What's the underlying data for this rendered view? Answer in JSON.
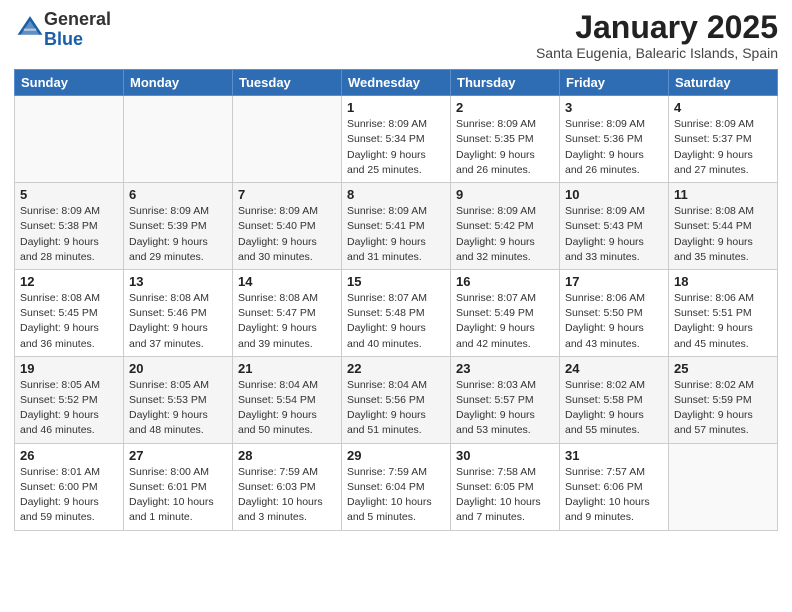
{
  "logo": {
    "text_general": "General",
    "text_blue": "Blue"
  },
  "header": {
    "month_title": "January 2025",
    "subtitle": "Santa Eugenia, Balearic Islands, Spain"
  },
  "weekdays": [
    "Sunday",
    "Monday",
    "Tuesday",
    "Wednesday",
    "Thursday",
    "Friday",
    "Saturday"
  ],
  "weeks": [
    [
      {
        "day": "",
        "info": ""
      },
      {
        "day": "",
        "info": ""
      },
      {
        "day": "",
        "info": ""
      },
      {
        "day": "1",
        "info": "Sunrise: 8:09 AM\nSunset: 5:34 PM\nDaylight: 9 hours\nand 25 minutes."
      },
      {
        "day": "2",
        "info": "Sunrise: 8:09 AM\nSunset: 5:35 PM\nDaylight: 9 hours\nand 26 minutes."
      },
      {
        "day": "3",
        "info": "Sunrise: 8:09 AM\nSunset: 5:36 PM\nDaylight: 9 hours\nand 26 minutes."
      },
      {
        "day": "4",
        "info": "Sunrise: 8:09 AM\nSunset: 5:37 PM\nDaylight: 9 hours\nand 27 minutes."
      }
    ],
    [
      {
        "day": "5",
        "info": "Sunrise: 8:09 AM\nSunset: 5:38 PM\nDaylight: 9 hours\nand 28 minutes."
      },
      {
        "day": "6",
        "info": "Sunrise: 8:09 AM\nSunset: 5:39 PM\nDaylight: 9 hours\nand 29 minutes."
      },
      {
        "day": "7",
        "info": "Sunrise: 8:09 AM\nSunset: 5:40 PM\nDaylight: 9 hours\nand 30 minutes."
      },
      {
        "day": "8",
        "info": "Sunrise: 8:09 AM\nSunset: 5:41 PM\nDaylight: 9 hours\nand 31 minutes."
      },
      {
        "day": "9",
        "info": "Sunrise: 8:09 AM\nSunset: 5:42 PM\nDaylight: 9 hours\nand 32 minutes."
      },
      {
        "day": "10",
        "info": "Sunrise: 8:09 AM\nSunset: 5:43 PM\nDaylight: 9 hours\nand 33 minutes."
      },
      {
        "day": "11",
        "info": "Sunrise: 8:08 AM\nSunset: 5:44 PM\nDaylight: 9 hours\nand 35 minutes."
      }
    ],
    [
      {
        "day": "12",
        "info": "Sunrise: 8:08 AM\nSunset: 5:45 PM\nDaylight: 9 hours\nand 36 minutes."
      },
      {
        "day": "13",
        "info": "Sunrise: 8:08 AM\nSunset: 5:46 PM\nDaylight: 9 hours\nand 37 minutes."
      },
      {
        "day": "14",
        "info": "Sunrise: 8:08 AM\nSunset: 5:47 PM\nDaylight: 9 hours\nand 39 minutes."
      },
      {
        "day": "15",
        "info": "Sunrise: 8:07 AM\nSunset: 5:48 PM\nDaylight: 9 hours\nand 40 minutes."
      },
      {
        "day": "16",
        "info": "Sunrise: 8:07 AM\nSunset: 5:49 PM\nDaylight: 9 hours\nand 42 minutes."
      },
      {
        "day": "17",
        "info": "Sunrise: 8:06 AM\nSunset: 5:50 PM\nDaylight: 9 hours\nand 43 minutes."
      },
      {
        "day": "18",
        "info": "Sunrise: 8:06 AM\nSunset: 5:51 PM\nDaylight: 9 hours\nand 45 minutes."
      }
    ],
    [
      {
        "day": "19",
        "info": "Sunrise: 8:05 AM\nSunset: 5:52 PM\nDaylight: 9 hours\nand 46 minutes."
      },
      {
        "day": "20",
        "info": "Sunrise: 8:05 AM\nSunset: 5:53 PM\nDaylight: 9 hours\nand 48 minutes."
      },
      {
        "day": "21",
        "info": "Sunrise: 8:04 AM\nSunset: 5:54 PM\nDaylight: 9 hours\nand 50 minutes."
      },
      {
        "day": "22",
        "info": "Sunrise: 8:04 AM\nSunset: 5:56 PM\nDaylight: 9 hours\nand 51 minutes."
      },
      {
        "day": "23",
        "info": "Sunrise: 8:03 AM\nSunset: 5:57 PM\nDaylight: 9 hours\nand 53 minutes."
      },
      {
        "day": "24",
        "info": "Sunrise: 8:02 AM\nSunset: 5:58 PM\nDaylight: 9 hours\nand 55 minutes."
      },
      {
        "day": "25",
        "info": "Sunrise: 8:02 AM\nSunset: 5:59 PM\nDaylight: 9 hours\nand 57 minutes."
      }
    ],
    [
      {
        "day": "26",
        "info": "Sunrise: 8:01 AM\nSunset: 6:00 PM\nDaylight: 9 hours\nand 59 minutes."
      },
      {
        "day": "27",
        "info": "Sunrise: 8:00 AM\nSunset: 6:01 PM\nDaylight: 10 hours\nand 1 minute."
      },
      {
        "day": "28",
        "info": "Sunrise: 7:59 AM\nSunset: 6:03 PM\nDaylight: 10 hours\nand 3 minutes."
      },
      {
        "day": "29",
        "info": "Sunrise: 7:59 AM\nSunset: 6:04 PM\nDaylight: 10 hours\nand 5 minutes."
      },
      {
        "day": "30",
        "info": "Sunrise: 7:58 AM\nSunset: 6:05 PM\nDaylight: 10 hours\nand 7 minutes."
      },
      {
        "day": "31",
        "info": "Sunrise: 7:57 AM\nSunset: 6:06 PM\nDaylight: 10 hours\nand 9 minutes."
      },
      {
        "day": "",
        "info": ""
      }
    ]
  ]
}
